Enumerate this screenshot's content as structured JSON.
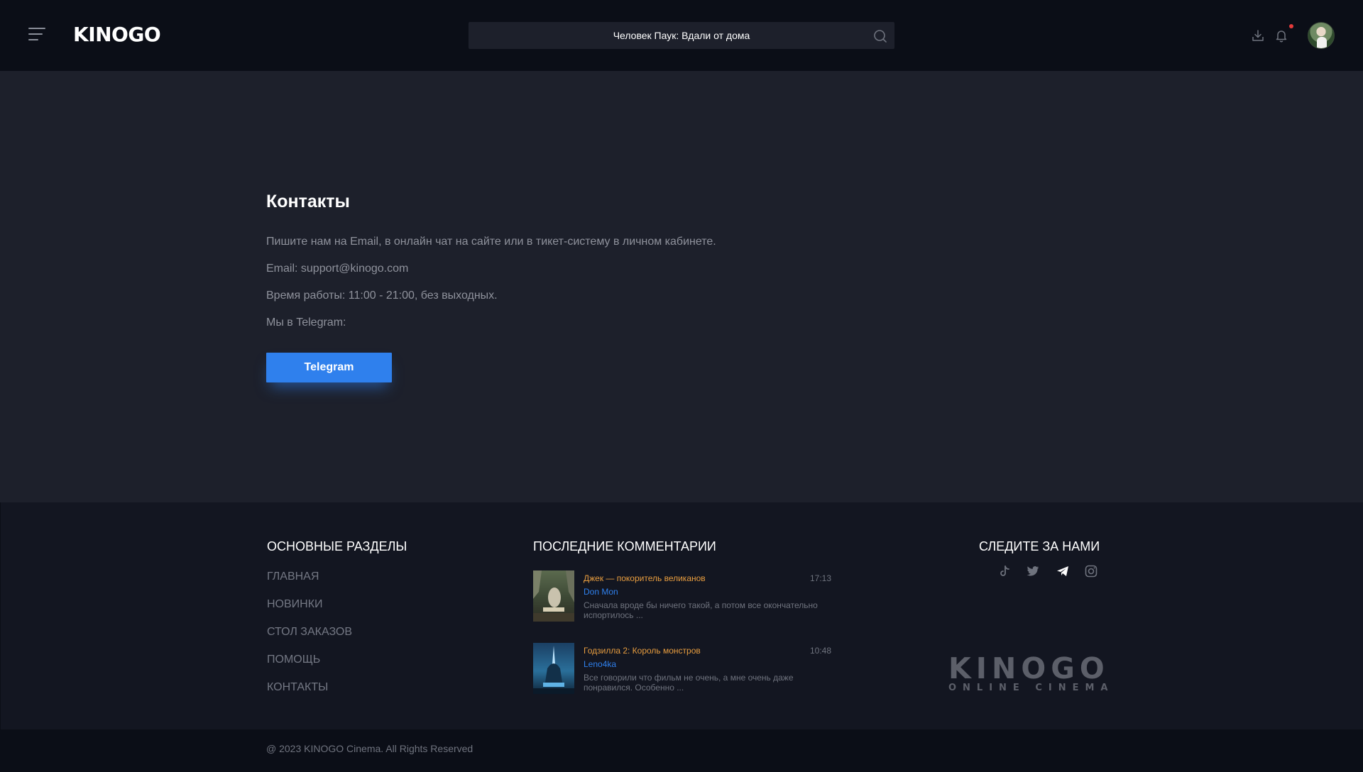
{
  "header": {
    "logo": "KINOGO",
    "search": {
      "value": "Человек Паук: Вдали от дома",
      "placeholder": ""
    },
    "icons": [
      "menu-icon",
      "search-icon",
      "download-icon",
      "bell-icon"
    ],
    "notification_dot_color": "#e53b3b"
  },
  "main": {
    "title": "Контакты",
    "paragraphs": [
      "Пишите нам на Email, в онлайн чат на сайте или в тикет-систему в личном кабинете.",
      "Email: support@kinogo.com",
      "Время работы: 11:00 - 21:00, без выходных.",
      "Мы в Telegram:"
    ],
    "telegram_button": "Telegram",
    "accent_color": "#2f80ed"
  },
  "footer": {
    "sections": {
      "heading": "ОСНОВНЫЕ РАЗДЕЛЫ",
      "links": [
        "ГЛАВНАЯ",
        "НОВИНКИ",
        "СТОЛ ЗАКАЗОВ",
        "ПОМОЩЬ",
        "КОНТАКТЫ"
      ]
    },
    "comments": {
      "heading": "ПОСЛЕДНИЕ КОММЕНТАРИИ",
      "items": [
        {
          "title": "Джек — покоритель великанов",
          "user": "Don Mon",
          "time": "17:13",
          "text": "Сначала вроде бы ничего такой, а потом все окончательно испортилось ..."
        },
        {
          "title": "Годзилла 2: Король монстров",
          "user": "Leno4ka",
          "time": "10:48",
          "text": "Все говорили что фильм не очень, а мне очень даже понравился. Особенно ..."
        }
      ]
    },
    "follow": {
      "heading": "СЛЕДИТЕ ЗА НАМИ",
      "icons": [
        "tiktok-icon",
        "twitter-icon",
        "telegram-icon",
        "instagram-icon"
      ]
    },
    "brand": {
      "name": "KINOGO",
      "tagline": "ONLINE CINEMA"
    },
    "copyright": "@ 2023 KINOGO Cinema. All Rights Reserved"
  }
}
